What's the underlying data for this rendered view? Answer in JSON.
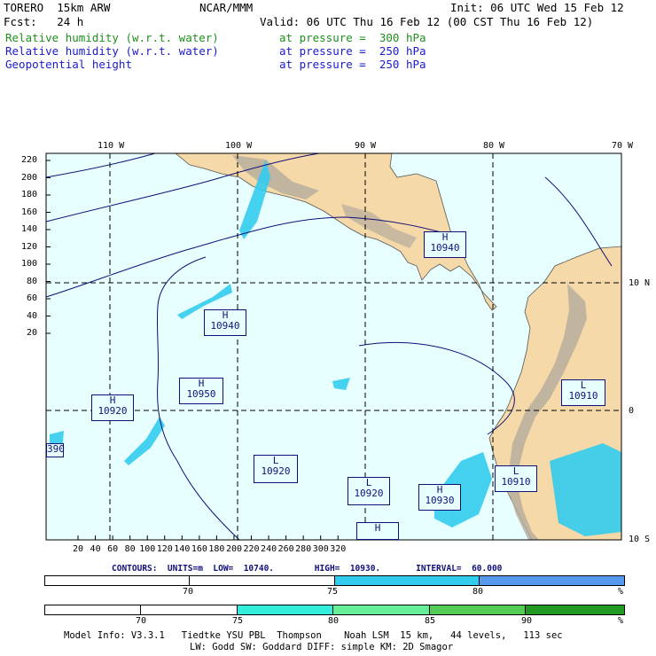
{
  "header": {
    "model": "TORERO  15km ARW",
    "org": "NCAR/MMM",
    "init": "Init: 06 UTC Wed 15 Feb 12",
    "fcst": "Fcst:   24 h",
    "valid": "Valid: 06 UTC Thu 16 Feb 12 (00 CST Thu 16 Feb 12)",
    "fields": [
      {
        "name": "Relative humidity (w.r.t. water)",
        "level": "at pressure =  300 hPa",
        "color": "#1f8f1f"
      },
      {
        "name": "Relative humidity (w.r.t. water)",
        "level": "at pressure =  250 hPa",
        "color": "#1a1ad0"
      },
      {
        "name": "Geopotential height",
        "level": "at pressure =  250 hPa",
        "color": "#1a1ad0"
      }
    ]
  },
  "map": {
    "lon_labels": [
      "110 W",
      "100 W",
      "90 W",
      "80 W",
      "70 W"
    ],
    "lat_labels": [
      "10 N",
      "0",
      "10 S"
    ],
    "y_ticks": [
      "220",
      "200",
      "180",
      "160",
      "140",
      "120",
      "100",
      "80",
      "60",
      "40",
      "20"
    ],
    "x_ticks": [
      "20",
      "40",
      "60",
      "80",
      "100",
      "120",
      "140",
      "160",
      "180",
      "200",
      "220",
      "240",
      "260",
      "280",
      "300",
      "320"
    ],
    "highs_lows": [
      {
        "letter": "H",
        "value": "10940"
      },
      {
        "letter": "H",
        "value": "10940"
      },
      {
        "letter": "H",
        "value": "10950"
      },
      {
        "letter": "H",
        "value": "10920"
      },
      {
        "letter": "L",
        "value": "10910"
      },
      {
        "letter": "L",
        "value": "10920"
      },
      {
        "letter": "L",
        "value": "10920"
      },
      {
        "letter": "H",
        "value": "10930"
      },
      {
        "letter": "L",
        "value": "10910"
      },
      {
        "letter": "H",
        "value": ""
      },
      {
        "letter": "",
        "value": "390"
      }
    ],
    "colors": {
      "ocean": "#e8ffff",
      "land": "#f5d9a8",
      "terrain": "#b5ab9c",
      "moist": "#33ccee"
    }
  },
  "contours": {
    "line": "CONTOURS:  UNITS=m  LOW=  10740.        HIGH=  10930.       INTERVAL=  60.000"
  },
  "legend_blue": {
    "labels": [
      "70",
      "75",
      "80",
      "%"
    ],
    "colors": [
      "#ffffff",
      "#ffffff",
      "#33ccee",
      "#5599ee"
    ]
  },
  "legend_green": {
    "labels": [
      "70",
      "75",
      "80",
      "85",
      "90",
      "%"
    ],
    "colors": [
      "#ffffff",
      "#ffffff",
      "#33eedd",
      "#66ee99",
      "#55cc55",
      "#229922"
    ]
  },
  "footer": {
    "line1": "Model Info: V3.3.1   Tiedtke YSU PBL  Thompson    Noah LSM  15 km,   44 levels,   113 sec",
    "line2": "LW: Godd SW: Goddard DIFF: simple KM: 2D Smagor"
  }
}
